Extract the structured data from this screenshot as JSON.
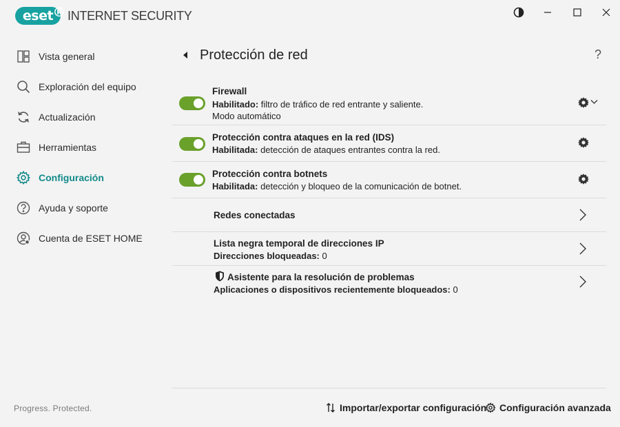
{
  "app": {
    "logo_text": "eset",
    "logo_reg": "®",
    "product_name": "INTERNET SECURITY",
    "brand_color": "#17a2a1"
  },
  "window_controls": {
    "theme": "contrast-icon",
    "minimize": "─",
    "maximize": "☐",
    "close": "✕"
  },
  "sidebar": {
    "items": [
      {
        "label": "Vista general",
        "icon": "dashboard-icon",
        "active": false
      },
      {
        "label": "Exploración del equipo",
        "icon": "search-icon",
        "active": false
      },
      {
        "label": "Actualización",
        "icon": "refresh-icon",
        "active": false
      },
      {
        "label": "Herramientas",
        "icon": "toolbox-icon",
        "active": false
      },
      {
        "label": "Configuración",
        "icon": "gear-icon",
        "active": true
      },
      {
        "label": "Ayuda y soporte",
        "icon": "help-icon",
        "active": false
      },
      {
        "label": "Cuenta de ESET HOME",
        "icon": "account-icon",
        "active": false
      }
    ],
    "footer": "Progress. Protected."
  },
  "main": {
    "title": "Protección de red",
    "help": "?",
    "features": [
      {
        "title": "Firewall",
        "status_label": "Habilitado:",
        "status_text": " filtro de tráfico de red entrante y saliente.",
        "extra": "Modo automático",
        "enabled": true
      },
      {
        "title": "Protección contra ataques en la red (IDS)",
        "status_label": "Habilitada:",
        "status_text": " detección de ataques entrantes contra la red.",
        "enabled": true
      },
      {
        "title": "Protección contra botnets",
        "status_label": "Habilitada:",
        "status_text": " detección y bloqueo de la comunicación de botnet.",
        "enabled": true
      }
    ],
    "links": [
      {
        "title": "Redes conectadas"
      },
      {
        "title": "Lista negra temporal de direcciones IP",
        "desc_label": "Direcciones bloqueadas:",
        "desc_value": "0"
      },
      {
        "title": "Asistente para la resolución de problemas",
        "desc_label": "Aplicaciones o dispositivos recientemente bloqueados:",
        "desc_value": "0"
      }
    ],
    "bottom": {
      "import_export": "Importar/exportar configuración",
      "advanced": "Configuración avanzada"
    }
  },
  "colors": {
    "toggle_on": "#6aa12b",
    "active_nav": "#138a89"
  }
}
